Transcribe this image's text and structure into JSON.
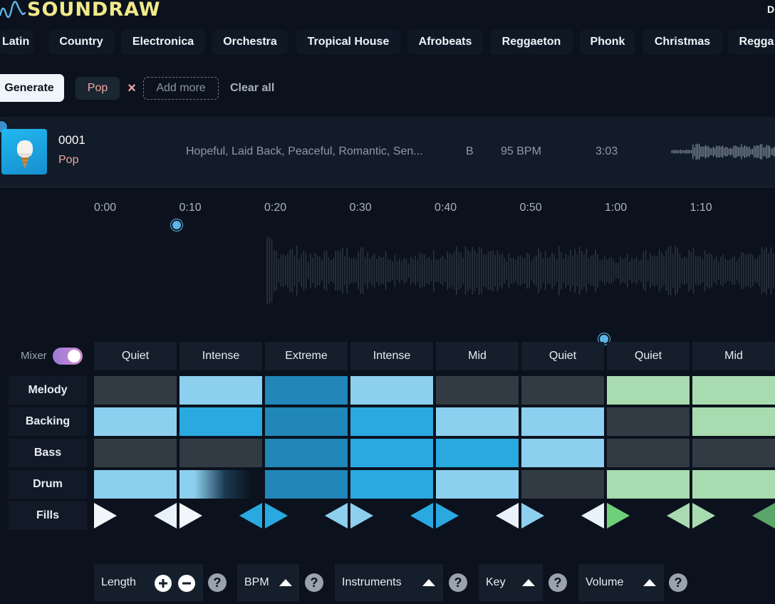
{
  "header": {
    "logo_text": "SOUNDRAW",
    "topright_label": "D"
  },
  "genres": [
    "Latin",
    "Country",
    "Electronica",
    "Orchestra",
    "Tropical House",
    "Afrobeats",
    "Reggaeton",
    "Phonk",
    "Christmas",
    "Regga"
  ],
  "filters": {
    "generate_label": "Generate",
    "chips": [
      "Pop"
    ],
    "remove_icon": "×",
    "add_more_label": "Add more",
    "clear_all_label": "Clear all"
  },
  "track": {
    "number": "0001",
    "genre": "Pop",
    "tags": "Hopeful, Laid Back, Peaceful, Romantic, Sen...",
    "key": "B",
    "bpm": "95 BPM",
    "duration": "3:03"
  },
  "timeline": {
    "ticks": [
      "0:00",
      "0:10",
      "0:20",
      "0:30",
      "0:40",
      "0:50",
      "1:00",
      "1:10"
    ],
    "played_fraction": 0.135
  },
  "mixer": {
    "label": "Mixer",
    "enabled": true,
    "sections": [
      "Quiet",
      "Intense",
      "Extreme",
      "Intense",
      "Mid",
      "Quiet",
      "Quiet",
      "Mid"
    ],
    "rows": [
      {
        "name": "Melody",
        "levels": [
          0,
          1,
          3,
          1,
          0,
          0,
          4,
          4
        ]
      },
      {
        "name": "Backing",
        "levels": [
          1,
          2,
          3,
          2,
          1,
          1,
          0,
          4
        ]
      },
      {
        "name": "Bass",
        "levels": [
          0,
          0,
          3,
          2,
          2,
          1,
          0,
          0
        ]
      },
      {
        "name": "Drum",
        "levels": [
          1,
          5,
          3,
          2,
          1,
          0,
          4,
          4
        ]
      }
    ],
    "fills_label": "Fills"
  },
  "colors": {
    "off": "#323a44",
    "low": "#8dcfee",
    "mid": "#29a9e0",
    "high": "#2186b8",
    "green": "#a8dbb0",
    "accent_green": "#6fd07a",
    "logo": "#f2e98a",
    "chip_text": "#f0a8a0"
  },
  "controls": {
    "length_label": "Length",
    "bpm_label": "BPM",
    "instruments_label": "Instruments",
    "key_label": "Key",
    "volume_label": "Volume",
    "help_symbol": "?"
  }
}
